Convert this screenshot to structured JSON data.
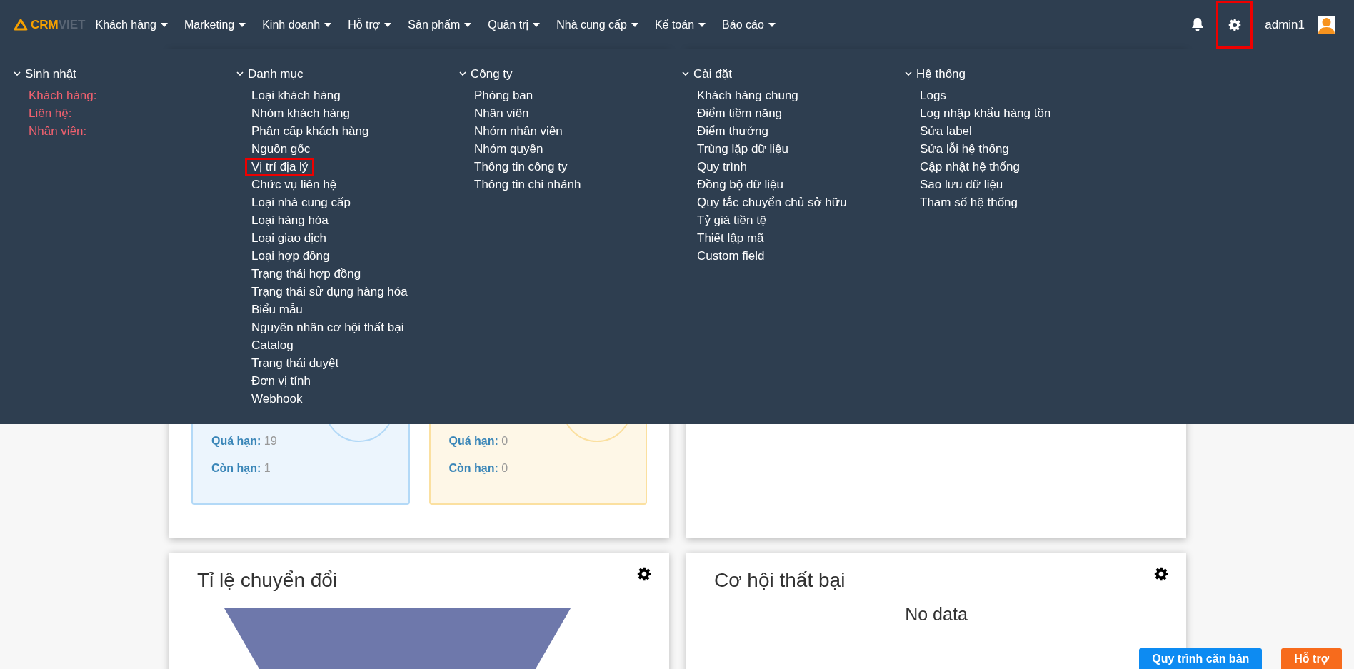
{
  "logo": {
    "brand": "CRM",
    "suffix": "VIET"
  },
  "nav": [
    {
      "label": "Khách hàng"
    },
    {
      "label": "Marketing"
    },
    {
      "label": "Kinh doanh"
    },
    {
      "label": "Hỗ trợ"
    },
    {
      "label": "Sản phẩm"
    },
    {
      "label": "Quản trị"
    },
    {
      "label": "Nhà cung cấp"
    },
    {
      "label": "Kế toán"
    },
    {
      "label": "Báo cáo"
    }
  ],
  "header_right": {
    "settings_highlighted": true,
    "user": "admin1"
  },
  "mega_menu": {
    "columns": [
      {
        "title": "Sinh nhật",
        "kind": "alert",
        "items": [
          {
            "label": "Khách hàng:",
            "highlighted": false
          },
          {
            "label": "Liên hệ:",
            "highlighted": false
          },
          {
            "label": "Nhân viên:",
            "highlighted": false
          }
        ]
      },
      {
        "title": "Danh mục",
        "kind": "links",
        "items": [
          {
            "label": "Loại khách hàng",
            "highlighted": false
          },
          {
            "label": "Nhóm khách hàng",
            "highlighted": false
          },
          {
            "label": "Phân cấp khách hàng",
            "highlighted": false
          },
          {
            "label": "Nguồn gốc",
            "highlighted": false
          },
          {
            "label": "Vị trí địa lý",
            "highlighted": true
          },
          {
            "label": "Chức vụ liên hệ",
            "highlighted": false
          },
          {
            "label": "Loại nhà cung cấp",
            "highlighted": false
          },
          {
            "label": "Loại hàng hóa",
            "highlighted": false
          },
          {
            "label": "Loại giao dịch",
            "highlighted": false
          },
          {
            "label": "Loại hợp đồng",
            "highlighted": false
          },
          {
            "label": "Trạng thái hợp đồng",
            "highlighted": false
          },
          {
            "label": "Trạng thái sử dụng hàng hóa",
            "highlighted": false
          },
          {
            "label": "Biểu mẫu",
            "highlighted": false
          },
          {
            "label": "Nguyên nhân cơ hội thất bại",
            "highlighted": false
          },
          {
            "label": "Catalog",
            "highlighted": false
          },
          {
            "label": "Trạng thái duyệt",
            "highlighted": false
          },
          {
            "label": "Đơn vị tính",
            "highlighted": false
          },
          {
            "label": "Webhook",
            "highlighted": false
          }
        ]
      },
      {
        "title": "Công ty",
        "kind": "links",
        "items": [
          {
            "label": "Phòng ban",
            "highlighted": false
          },
          {
            "label": "Nhân viên",
            "highlighted": false
          },
          {
            "label": "Nhóm nhân viên",
            "highlighted": false
          },
          {
            "label": "Nhóm quyền",
            "highlighted": false
          },
          {
            "label": "Thông tin công ty",
            "highlighted": false
          },
          {
            "label": "Thông tin chi nhánh",
            "highlighted": false
          }
        ]
      },
      {
        "title": "Cài đặt",
        "kind": "links",
        "items": [
          {
            "label": "Khách hàng chung",
            "highlighted": false
          },
          {
            "label": "Điểm tiềm năng",
            "highlighted": false
          },
          {
            "label": "Điểm thưởng",
            "highlighted": false
          },
          {
            "label": "Trùng lặp dữ liệu",
            "highlighted": false
          },
          {
            "label": "Quy trình",
            "highlighted": false
          },
          {
            "label": "Đồng bộ dữ liệu",
            "highlighted": false
          },
          {
            "label": "Quy tắc chuyển chủ sở hữu",
            "highlighted": false
          },
          {
            "label": "Tỷ giá tiền tệ",
            "highlighted": false
          },
          {
            "label": "Thiết lập mã",
            "highlighted": false
          },
          {
            "label": "Custom field",
            "highlighted": false
          }
        ]
      },
      {
        "title": "Hệ thống",
        "kind": "links",
        "items": [
          {
            "label": "Logs",
            "highlighted": false
          },
          {
            "label": "Log nhập khẩu hàng tồn",
            "highlighted": false
          },
          {
            "label": "Sửa label",
            "highlighted": false
          },
          {
            "label": "Sửa lỗi hệ thống",
            "highlighted": false
          },
          {
            "label": "Cập nhật hệ thống",
            "highlighted": false
          },
          {
            "label": "Sao lưu dữ liệu",
            "highlighted": false
          },
          {
            "label": "Tham số hệ thống",
            "highlighted": false
          }
        ]
      }
    ]
  },
  "deadline_cards": [
    {
      "color": "#b3d9f7",
      "stats": [
        {
          "label": "Quá hạn:",
          "value": "19"
        },
        {
          "label": "Còn hạn:",
          "value": "1"
        }
      ]
    },
    {
      "color": "#fbe0a0",
      "stats": [
        {
          "label": "Quá hạn:",
          "value": "0"
        },
        {
          "label": "Còn hạn:",
          "value": "0"
        }
      ]
    }
  ],
  "bottom_cards": [
    {
      "title": "Tỉ lệ chuyển đổi",
      "kind": "funnel"
    },
    {
      "title": "Cơ hội thất bại",
      "kind": "empty",
      "message": "No data"
    }
  ],
  "floating_buttons": [
    {
      "label": "Quy trình căn bản",
      "color": "#0d8bf2"
    },
    {
      "label": "Hỗ trợ",
      "color": "#f76b1c"
    }
  ]
}
